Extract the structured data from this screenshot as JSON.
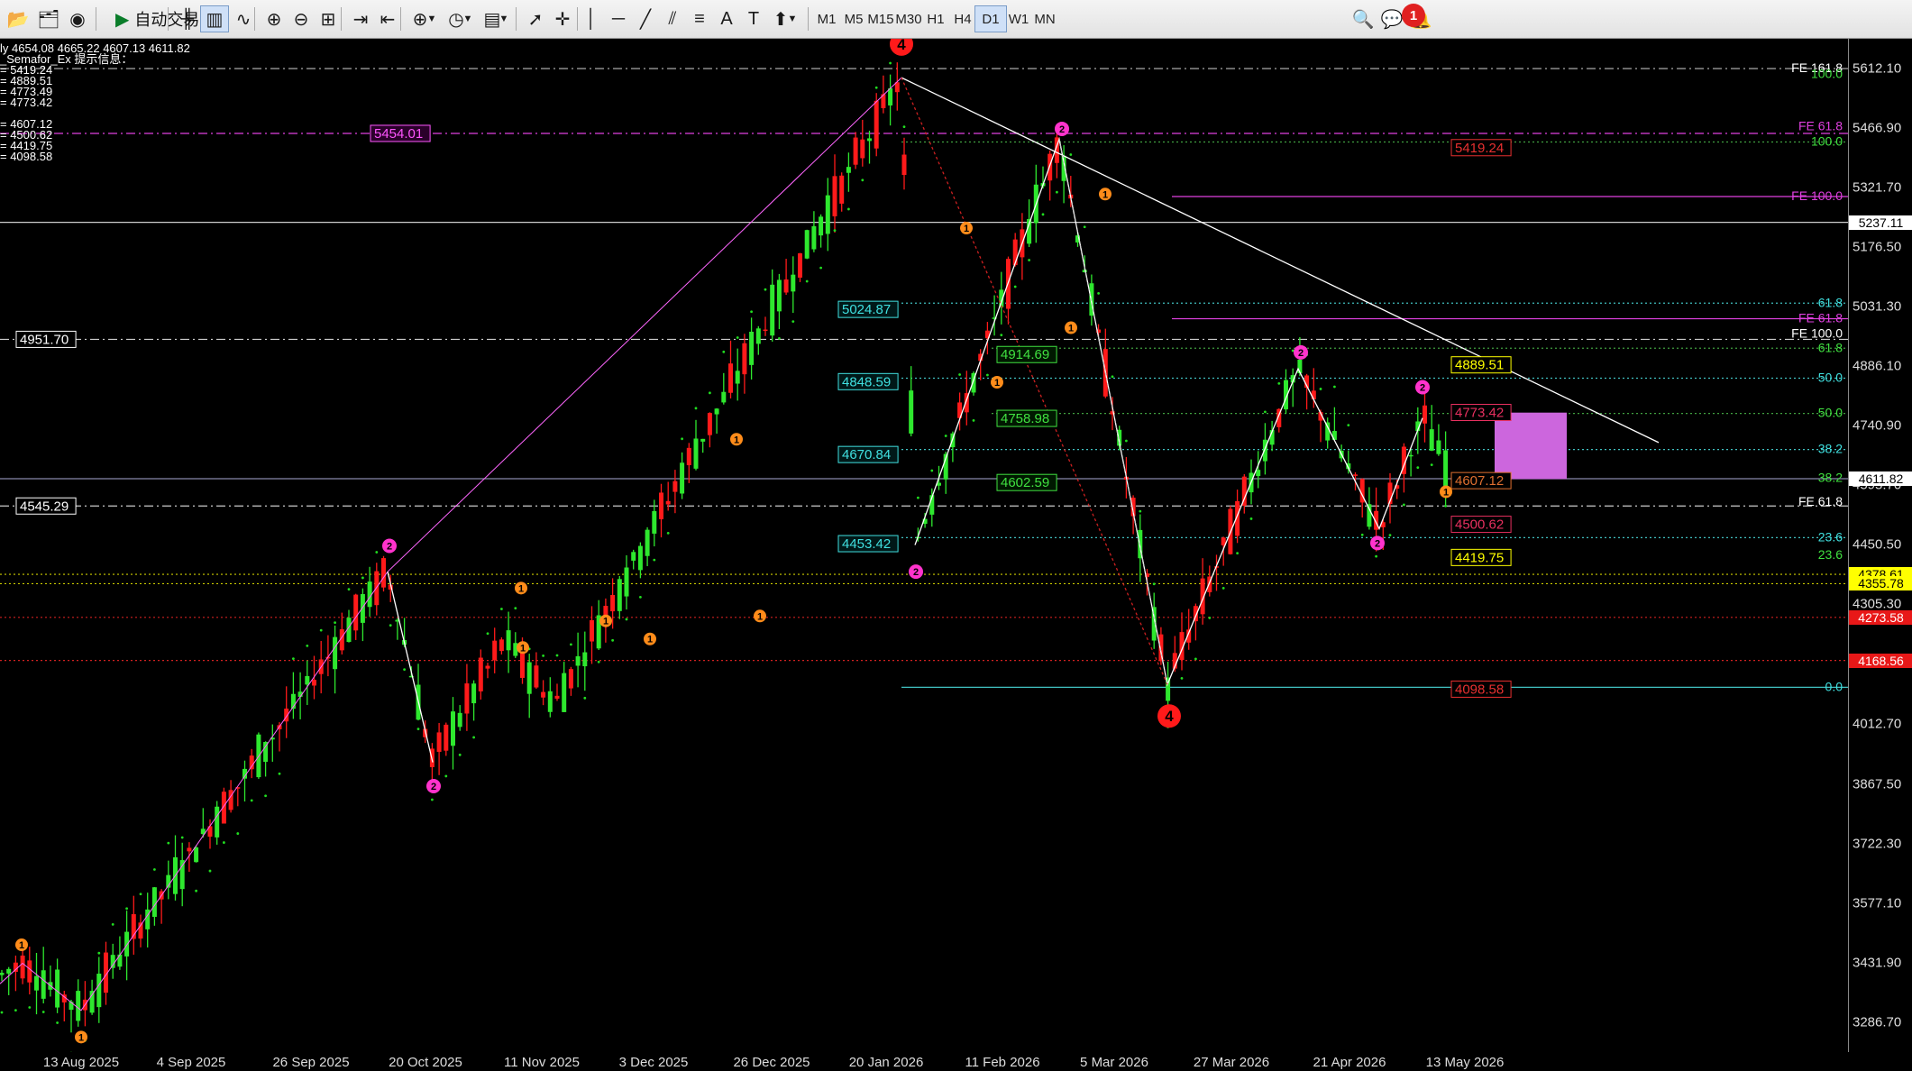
{
  "toolbar": {
    "autotrade_label": "自动交易",
    "timeframes": [
      "M1",
      "M5",
      "M15",
      "M30",
      "H1",
      "H4",
      "D1",
      "W1",
      "MN"
    ],
    "active_timeframe": "D1",
    "notification_count": "1"
  },
  "info": {
    "ohlc_line": "ly  4654.08 4665.22 4607.13 4611.82",
    "indicator_title": "_Semafor_Ex 提示信息：",
    "values": [
      "= 5419.24",
      "= 4889.51",
      "= 4773.49",
      "= 4773.42",
      "",
      "= 4607.12",
      "= 4500.62",
      "= 4419.75",
      "= 4098.58"
    ]
  },
  "price_axis": {
    "min": 3213.41,
    "max": 5684.8,
    "ticks": [
      "5612.10",
      "5466.90",
      "5321.70",
      "5176.50",
      "5031.30",
      "4886.10",
      "4740.90",
      "4595.70",
      "4450.50",
      "4305.30",
      "4160.10",
      "4012.70",
      "3867.50",
      "3722.30",
      "3577.10",
      "3431.90",
      "3286.70"
    ],
    "tags": [
      {
        "text": "5237.11",
        "price": 5237.11,
        "bg": "#ffffff",
        "fg": "#000000"
      },
      {
        "text": "4611.82",
        "price": 4611.82,
        "bg": "#ffffff",
        "fg": "#000000"
      },
      {
        "text": "4378.61",
        "price": 4378.61,
        "bg": "#ffff00",
        "fg": "#000000"
      },
      {
        "text": "4355.78",
        "price": 4355.78,
        "bg": "#ffff00",
        "fg": "#000000"
      },
      {
        "text": "4273.58",
        "price": 4273.58,
        "bg": "#e81818",
        "fg": "#ffffff"
      },
      {
        "text": "4168.56",
        "price": 4168.56,
        "bg": "#e81818",
        "fg": "#ffffff"
      }
    ]
  },
  "date_labels": [
    "13 Aug 2025",
    "4 Sep 2025",
    "26 Sep 2025",
    "20 Oct 2025",
    "11 Nov 2025",
    "3 Dec 2025",
    "26 Dec 2025",
    "20 Jan 2026",
    "11 Feb 2026",
    "5 Mar 2026",
    "27 Mar 2026",
    "21 Apr 2026",
    "13 May 2026"
  ],
  "levels_left": [
    {
      "text": "4951.70",
      "price": 4951.7
    },
    {
      "text": "4545.29",
      "price": 4545.29
    }
  ],
  "level_magenta": {
    "text": "5454.01",
    "price": 5454.01
  },
  "fib_labels_cyan": [
    {
      "text": "5024.87",
      "price": 5024.87
    },
    {
      "text": "4848.59",
      "price": 4848.59
    },
    {
      "text": "4670.84",
      "price": 4670.84
    },
    {
      "text": "4453.42",
      "price": 4453.42
    }
  ],
  "fib_labels_green": [
    {
      "text": "4914.69",
      "price": 4914.69
    },
    {
      "text": "4758.98",
      "price": 4758.98
    },
    {
      "text": "4602.59",
      "price": 4602.59
    }
  ],
  "right_boxes": [
    {
      "text": "5419.24",
      "price": 5419.24,
      "color": "#e83030"
    },
    {
      "text": "4889.51",
      "price": 4889.51,
      "color": "#ffff00"
    },
    {
      "text": "4773.42",
      "price": 4773.42,
      "color": "#e83060"
    },
    {
      "text": "4607.12",
      "price": 4607.12,
      "color": "#e07030"
    },
    {
      "text": "4500.62",
      "price": 4500.62,
      "color": "#e83060"
    },
    {
      "text": "4419.75",
      "price": 4419.75,
      "color": "#ffff00"
    },
    {
      "text": "4098.58",
      "price": 4098.58,
      "color": "#e83030"
    }
  ],
  "fib_ratio_labels": [
    {
      "text": "FE 161.8",
      "price": 5612.1,
      "color": "#ffffff"
    },
    {
      "text": "100.0",
      "price": 5598.0,
      "color": "#40e040"
    },
    {
      "text": "FE 61.8",
      "price": 5470.0,
      "color": "#e040e0"
    },
    {
      "text": "100.0",
      "price": 5433.0,
      "color": "#40e040"
    },
    {
      "text": "FE 100.0",
      "price": 5300.0,
      "color": "#e040e0"
    },
    {
      "text": "61.8",
      "price": 5040.0,
      "color": "#40e0e0"
    },
    {
      "text": "FE 61.8",
      "price": 5002.0,
      "color": "#e040e0"
    },
    {
      "text": "FE 100.0",
      "price": 4965.0,
      "color": "#ffffff"
    },
    {
      "text": "61.8",
      "price": 4930.0,
      "color": "#40e040"
    },
    {
      "text": "50.0",
      "price": 4857.0,
      "color": "#40e0e0"
    },
    {
      "text": "50.0",
      "price": 4771.0,
      "color": "#40e040"
    },
    {
      "text": "38.2",
      "price": 4683.0,
      "color": "#40e0e0"
    },
    {
      "text": "38.2",
      "price": 4613.0,
      "color": "#40e040"
    },
    {
      "text": "FE 61.8",
      "price": 4555.0,
      "color": "#ffffff"
    },
    {
      "text": "23.6",
      "price": 4468.0,
      "color": "#40e0e0"
    },
    {
      "text": "23.6",
      "price": 4425.0,
      "color": "#40e040"
    },
    {
      "text": "0.0",
      "price": 4103.0,
      "color": "#40e0e0"
    }
  ],
  "semafor_labels": {
    "big": "4",
    "mid": "2",
    "small": "1"
  },
  "colors": {
    "bull": "#2ee82e",
    "bear": "#ff1a1a",
    "zigzag": "#ffffff",
    "fractal_pink": "#ff66ff",
    "target_box": "#cc66dd"
  }
}
